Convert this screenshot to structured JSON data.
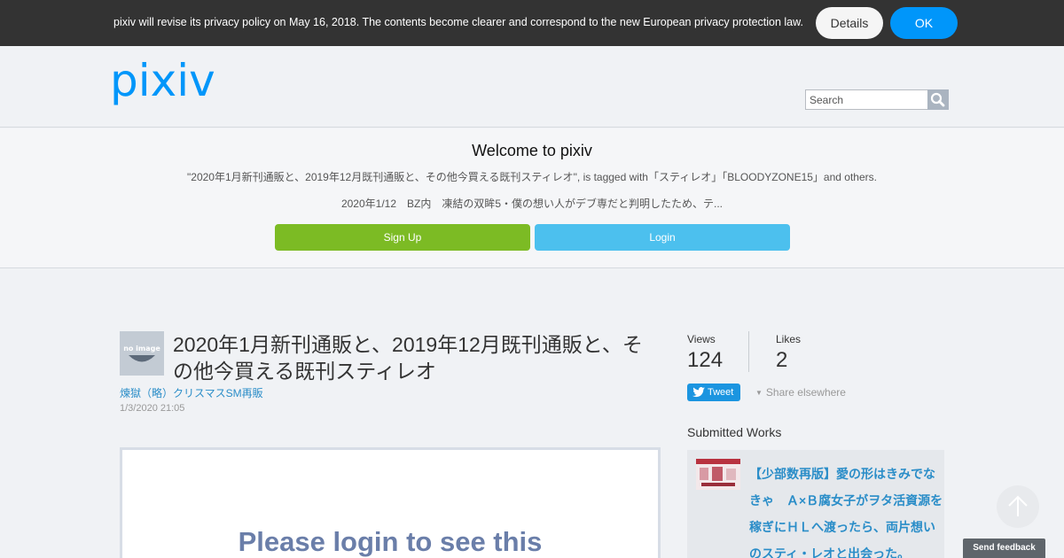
{
  "cookie_banner": {
    "message": "pixiv will revise its privacy policy on May 16, 2018. The contents become clearer and correspond to the new European privacy protection law.",
    "details_label": "Details",
    "ok_label": "OK"
  },
  "header": {
    "logo_text": "pixiv",
    "search_placeholder": "Search"
  },
  "welcome": {
    "title": "Welcome to pixiv",
    "description": "\"2020年1月新刊通販と、2019年12月既刊通販と、その他今買える既刊スティレオ\", is tagged with「スティレオ」「BLOODYZONE15」and others.",
    "caption": "2020年1/12　BZ内　凍結の双眸5・僕の想い人がデブ専だと判明したため、テ...",
    "signup_label": "Sign Up",
    "login_label": "Login"
  },
  "work": {
    "avatar_text": "no image",
    "title": "2020年1月新刊通販と、2019年12月既刊通販と、その他今買える既刊スティレオ",
    "author": "煉獄（略）クリスマスSM再販",
    "date": "1/3/2020 21:05",
    "login_prompt": "Please login to see this"
  },
  "stats": {
    "views_label": "Views",
    "views_value": "124",
    "likes_label": "Likes",
    "likes_value": "2",
    "tweet_label": "Tweet",
    "share_label": "Share elsewhere"
  },
  "submitted": {
    "heading": "Submitted Works",
    "items": [
      {
        "title": "【少部数再版】愛の形はきみでなきゃ　Ａ×Ｂ腐女子がヲタ活資源を稼ぎにＨＬへ渡ったら、両片想いのスティ・レオと出会った。"
      }
    ]
  },
  "feedback_label": "Send feedback",
  "colors": {
    "brand_blue": "#0096fa",
    "signup_green": "#7cbb24",
    "login_blue": "#4cc0ee",
    "link_blue": "#2a8dc8"
  }
}
